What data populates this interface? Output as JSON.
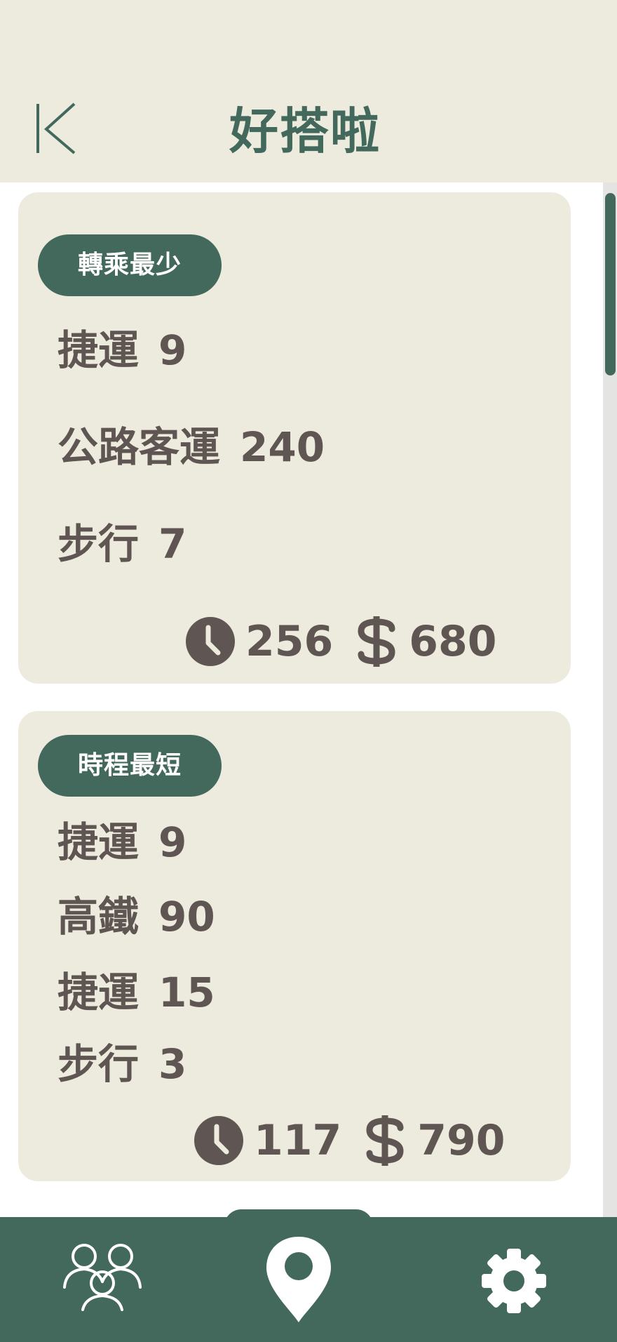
{
  "header": {
    "title": "好搭啦",
    "back_icon": "back-arrow-icon"
  },
  "routes": [
    {
      "badge": "轉乘最少",
      "segments": [
        {
          "mode": "捷運",
          "value": "9"
        },
        {
          "mode": "公路客運",
          "value": "240"
        },
        {
          "mode": "步行",
          "value": "7"
        }
      ],
      "duration": "256",
      "fare": "680"
    },
    {
      "badge": "時程最短",
      "segments": [
        {
          "mode": "捷運",
          "value": "9"
        },
        {
          "mode": "高鐵",
          "value": "90"
        },
        {
          "mode": "捷運",
          "value": "15"
        },
        {
          "mode": "步行",
          "value": "3"
        }
      ],
      "duration": "117",
      "fare": "790"
    }
  ],
  "bottom_nav": {
    "items": [
      "group-icon",
      "map-pin-icon",
      "gear-icon"
    ]
  },
  "colors": {
    "primary": "#43695d",
    "card_bg": "#ecebdd",
    "text": "#5f5552"
  }
}
